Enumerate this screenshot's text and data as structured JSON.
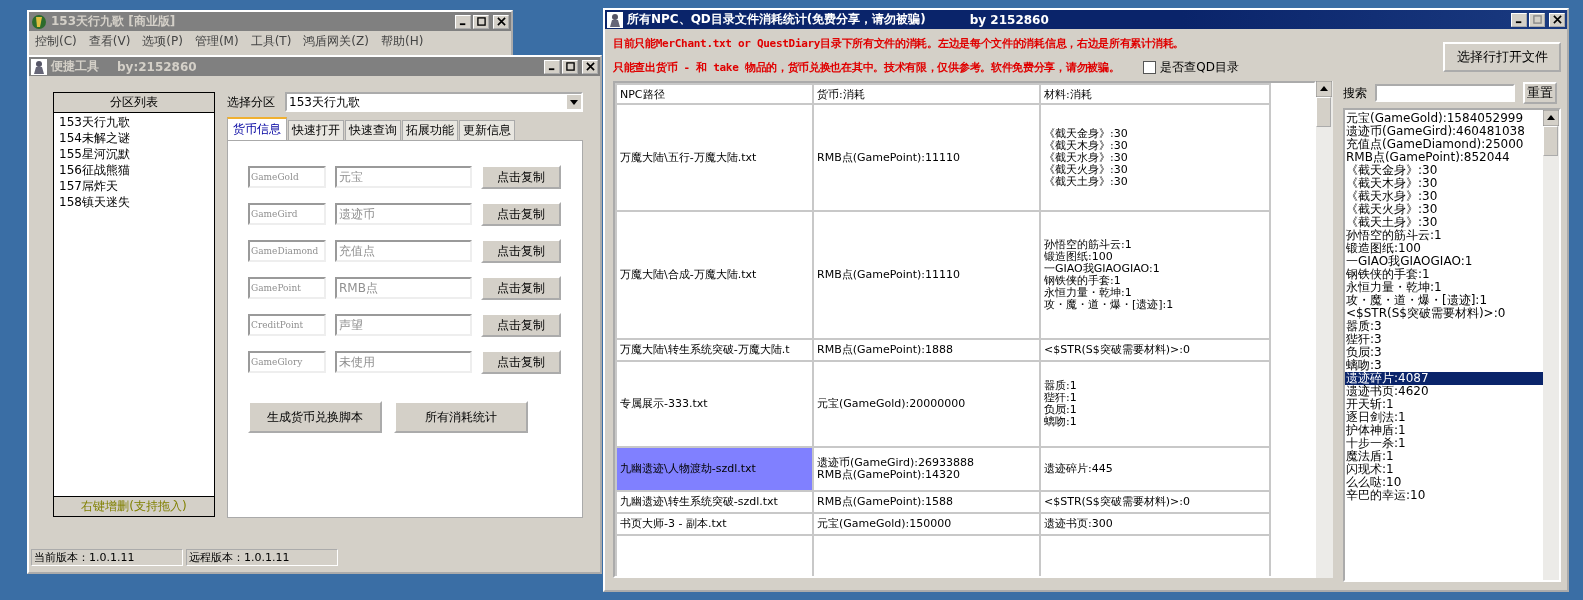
{
  "back_window": {
    "title": "153天行九歌 [商业版]",
    "active": false,
    "menu": [
      "控制(C)",
      "查看(V)",
      "选项(P)",
      "管理(M)",
      "工具(T)",
      "鸿盾网关(Z)",
      "帮助(H)"
    ]
  },
  "tool_window": {
    "title": "便捷工具",
    "author": "by:2152860",
    "active": false,
    "partition_list": {
      "header": "分区列表",
      "items": [
        {
          "label": "153天行九歌",
          "selected": false
        },
        {
          "label": "154未解之谜",
          "selected": false
        },
        {
          "label": "155星河沉默",
          "selected": false
        },
        {
          "label": "156征战熊猫",
          "selected": false
        },
        {
          "label": "157屌炸天",
          "selected": false
        },
        {
          "label": "158镇天迷失",
          "selected": false
        }
      ],
      "footer": "右键增删(支持拖入)"
    },
    "partition_select": {
      "label": "选择分区",
      "value": "153天行九歌"
    },
    "tabs": [
      {
        "label": "货币信息",
        "selected": true
      },
      {
        "label": "快速打开",
        "selected": false
      },
      {
        "label": "快速查询",
        "selected": false
      },
      {
        "label": "拓展功能",
        "selected": false
      },
      {
        "label": "更新信息",
        "selected": false
      }
    ],
    "currency_rows": [
      {
        "code": "GameGold",
        "name": "元宝",
        "disabled": true,
        "button": "点击复制"
      },
      {
        "code": "GameGird",
        "name": "遗迹币",
        "disabled": true,
        "button": "点击复制"
      },
      {
        "code": "GameDiamond",
        "name": "充值点",
        "disabled": true,
        "button": "点击复制"
      },
      {
        "code": "GamePoint",
        "name": "RMB点",
        "disabled": true,
        "button": "点击复制"
      },
      {
        "code": "CreditPoint",
        "name": "声望",
        "disabled": true,
        "button": "点击复制"
      },
      {
        "code": "GameGlory",
        "name": "未使用",
        "disabled": true,
        "button": "点击复制"
      }
    ],
    "actions": [
      "生成货币兑换脚本",
      "所有消耗统计"
    ],
    "status_bar": [
      "当前版本：1.0.1.11",
      "远程版本：1.0.1.11"
    ]
  },
  "stats_window": {
    "title": "所有NPC、QD目录文件消耗统计(免费分享，请勿被骗)",
    "author": "by 2152860",
    "active": true,
    "notices": [
      "目前只能MerChant.txt or QuestDiary目录下所有文件的消耗。左边是每个文件的消耗信息，右边是所有累计消耗。",
      "只能查出货币 - 和 take 物品的，货币兑换也在其中。技术有限，仅供参考。软件免费分享，请勿被骗。"
    ],
    "qd_checkbox": {
      "label": "是否查QD目录",
      "checked": false
    },
    "open_button": "选择行打开文件",
    "table": {
      "columns": [
        "NPC路径",
        "货币:消耗",
        "材料:消耗"
      ],
      "rows": [
        {
          "path": "万魔大陆\\五行-万魔大陆.txt",
          "currency": "RMB点(GamePoint):11110",
          "materials": "《截天金身》:30\n《截天木身》:30\n《截天水身》:30\n《截天火身》:30\n《截天土身》:30",
          "selected": false
        },
        {
          "path": "万魔大陆\\合成-万魔大陆.txt",
          "currency": "RMB点(GamePoint):11110",
          "materials": "孙悟空的筋斗云:1\n锻造图纸:100\n一GIAO我GIAOGIAO:1\n钢铁侠的手套:1\n永恒力量・乾坤:1\n攻・魔・道・爆・[遗迹]:1",
          "selected": false
        },
        {
          "path": "万魔大陆\\转生系统突破-万魔大陆.t",
          "currency": "RMB点(GamePoint):1888",
          "materials": "<$STR(S$突破需要材料)>:0",
          "selected": false
        },
        {
          "path": "专属展示-333.txt",
          "currency": "元宝(GameGold):20000000",
          "materials": "嚣质:1\n狴犴:1\n负屃:1\n螭吻:1",
          "selected": false
        },
        {
          "path": "九幽遗迹\\人物渡劫-szdl.txt",
          "currency": "遗迹币(GameGird):26933888\nRMB点(GamePoint):14320",
          "materials": "遗迹碎片:445",
          "selected": true
        },
        {
          "path": "九幽遗迹\\转生系统突破-szdl.txt",
          "currency": "RMB点(GamePoint):1588",
          "materials": "<$STR(S$突破需要材料)>:0",
          "selected": false
        },
        {
          "path": "书页大师-3 - 副本.txt",
          "currency": "元宝(GameGold):150000",
          "materials": "遗迹书页:300",
          "selected": false
        }
      ]
    },
    "search": {
      "label": "搜索",
      "reset": "重置"
    },
    "totals": [
      {
        "text": "元宝(GameGold):1584052999",
        "selected": false
      },
      {
        "text": "遗迹币(GameGird):460481038",
        "selected": false
      },
      {
        "text": "充值点(GameDiamond):25000",
        "selected": false
      },
      {
        "text": "RMB点(GamePoint):852044",
        "selected": false
      },
      {
        "text": "《截天金身》:30",
        "selected": false
      },
      {
        "text": "《截天木身》:30",
        "selected": false
      },
      {
        "text": "《截天水身》:30",
        "selected": false
      },
      {
        "text": "《截天火身》:30",
        "selected": false
      },
      {
        "text": "《截天土身》:30",
        "selected": false
      },
      {
        "text": "孙悟空的筋斗云:1",
        "selected": false
      },
      {
        "text": "锻造图纸:100",
        "selected": false
      },
      {
        "text": "一GIAO我GIAOGIAO:1",
        "selected": false
      },
      {
        "text": "钢铁侠的手套:1",
        "selected": false
      },
      {
        "text": "永恒力量・乾坤:1",
        "selected": false
      },
      {
        "text": "攻・魔・道・爆・[遗迹]:1",
        "selected": false
      },
      {
        "text": "<$STR(S$突破需要材料)>:0",
        "selected": false
      },
      {
        "text": "嚣质:3",
        "selected": false
      },
      {
        "text": "狴犴:3",
        "selected": false
      },
      {
        "text": "负屃:3",
        "selected": false
      },
      {
        "text": "螭吻:3",
        "selected": false
      },
      {
        "text": "遗迹碎片:4087",
        "selected": true
      },
      {
        "text": "遗迹书页:4620",
        "selected": false
      },
      {
        "text": "开天斩:1",
        "selected": false
      },
      {
        "text": "逐日剑法:1",
        "selected": false
      },
      {
        "text": "护体神盾:1",
        "selected": false
      },
      {
        "text": "十步一杀:1",
        "selected": false
      },
      {
        "text": "魔法盾:1",
        "selected": false
      },
      {
        "text": "闪现术:1",
        "selected": false
      },
      {
        "text": "么么哒:10",
        "selected": false
      },
      {
        "text": "辛巴的幸运:10",
        "selected": false
      }
    ]
  }
}
